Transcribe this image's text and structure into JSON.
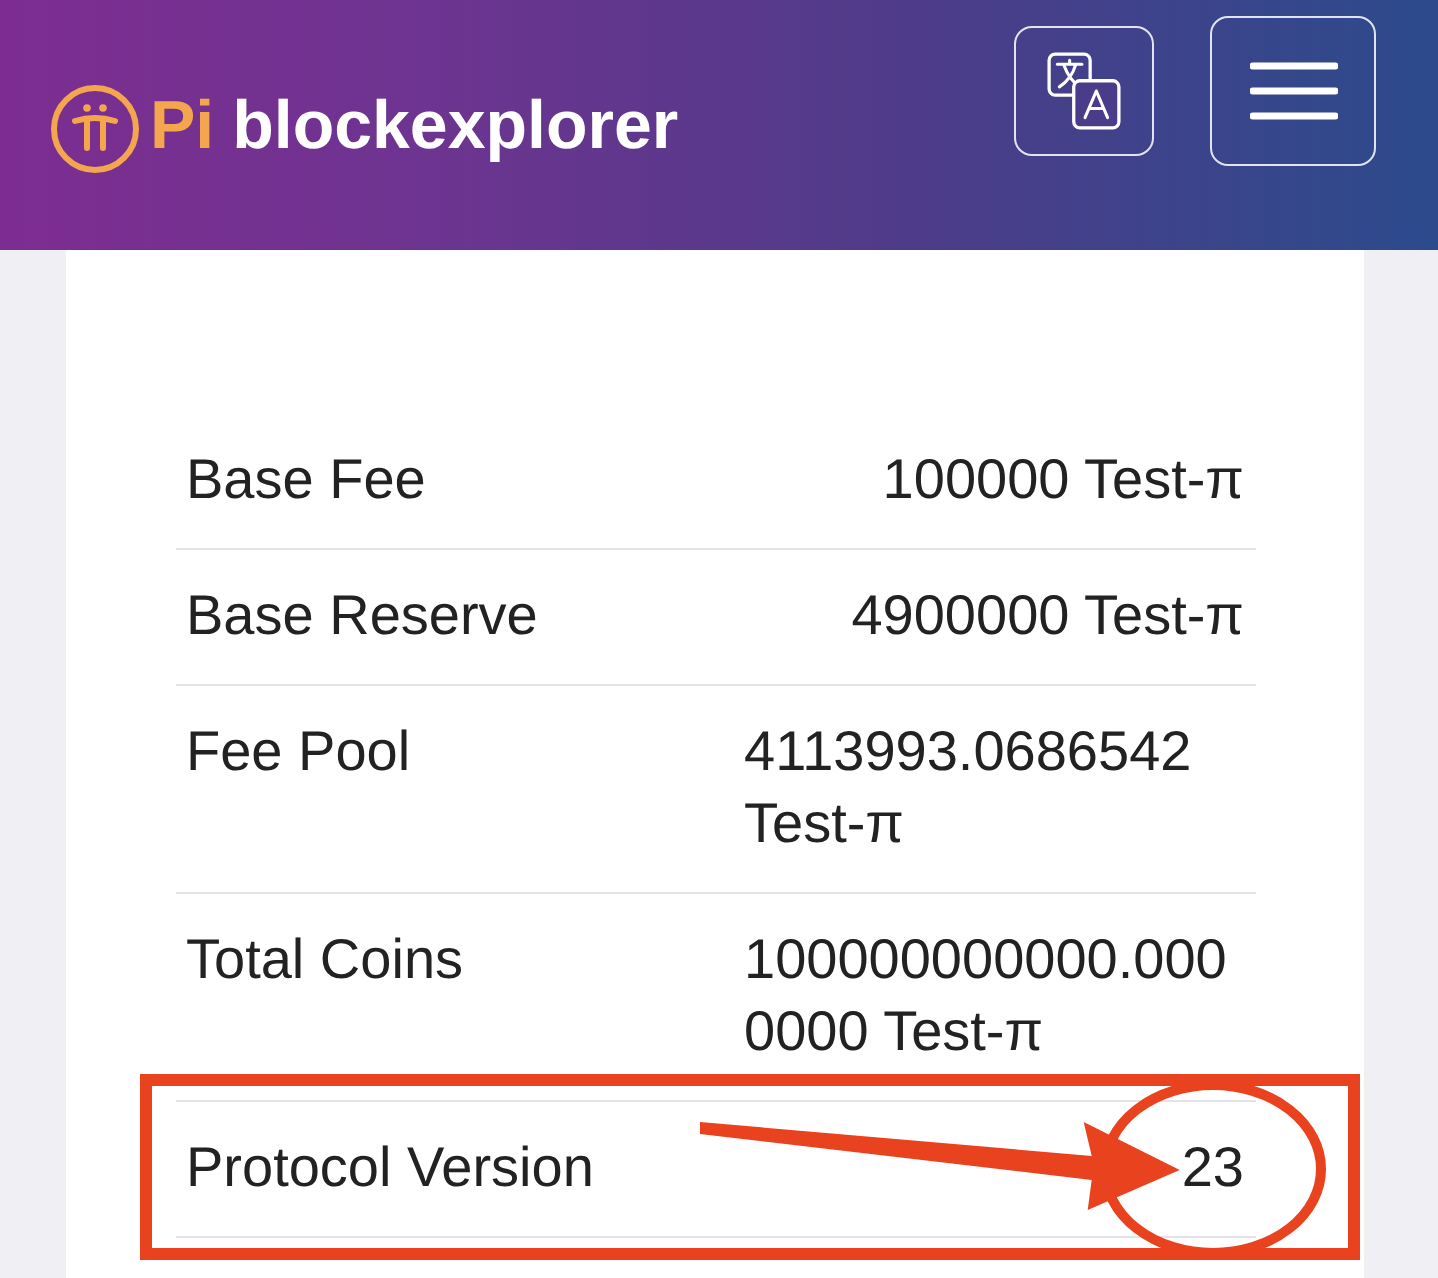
{
  "header": {
    "brand_prefix": "Pi",
    "brand_name": "blockexplorer"
  },
  "rows": [
    {
      "label": "Base Fee",
      "value": "100000 Test-π",
      "highlighted": false
    },
    {
      "label": "Base Reserve",
      "value": "4900000 Test-π",
      "highlighted": false
    },
    {
      "label": "Fee Pool",
      "value": "4113993.0686542 Test-π",
      "highlighted": false
    },
    {
      "label": "Total Coins",
      "value": "100000000000.0000000 Test-π",
      "highlighted": false
    },
    {
      "label": "Protocol Version",
      "value": "23",
      "highlighted": true
    }
  ]
}
